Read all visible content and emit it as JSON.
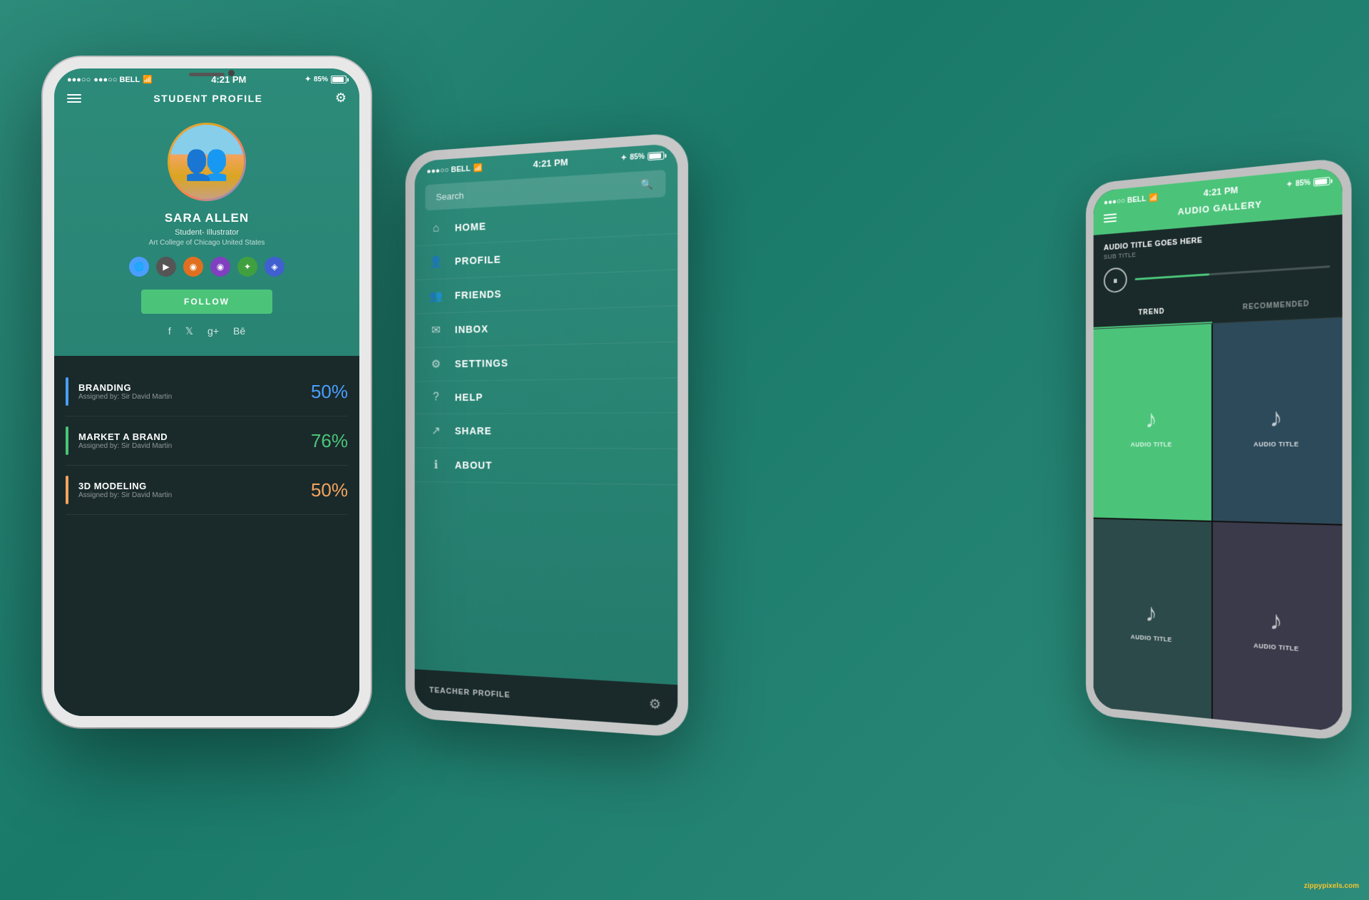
{
  "background": {
    "color": "#2d8b7a"
  },
  "phone1": {
    "status_bar": {
      "carrier": "●●●○○ BELL",
      "wifi": "WiFi",
      "time": "4:21 PM",
      "bluetooth": "✦",
      "battery": "85%"
    },
    "header": {
      "title": "STUDENT PROFILE"
    },
    "profile": {
      "name": "SARA ALLEN",
      "role": "Student- Illustrator",
      "school": "Art College of Chicago United States"
    },
    "follow_button": "FOLLOW",
    "social_links": [
      "f",
      "𝕏",
      "g+",
      "Bē"
    ],
    "courses": [
      {
        "name": "BRANDING",
        "assigned": "Assigned by: Sir David Martin",
        "percent": "50%",
        "color": "#4a9eff",
        "color_class": "blue"
      },
      {
        "name": "MARKET A BRAND",
        "assigned": "Assigned by: Sir David Martin",
        "percent": "76%",
        "color": "#4bc47a",
        "color_class": "green"
      },
      {
        "name": "3D Modeling",
        "assigned": "Assigned by: Sir David Martin",
        "percent": "50%",
        "color": "#f4a460",
        "color_class": "orange"
      }
    ]
  },
  "phone2": {
    "status_bar": {
      "carrier": "●●●○○ BELL",
      "wifi": "WiFi",
      "time": "4:21 PM",
      "bluetooth": "✦",
      "battery": "85%"
    },
    "search": {
      "placeholder": "Search"
    },
    "menu_items": [
      {
        "label": "HOME",
        "icon": "⌂"
      },
      {
        "label": "PROFILE",
        "icon": "♟"
      },
      {
        "label": "FRIENDS",
        "icon": "♟♟"
      },
      {
        "label": "INBOX",
        "icon": "✉"
      },
      {
        "label": "SETTINGS",
        "icon": "⚙"
      },
      {
        "label": "HELP",
        "icon": "?"
      },
      {
        "label": "SHARE",
        "icon": "↗"
      },
      {
        "label": "ABOUT",
        "icon": "ℹ"
      }
    ],
    "teacher_profile_label": "TEACHER PROFILE"
  },
  "phone3": {
    "status_bar": {
      "carrier": "●●●○○ BELL",
      "wifi": "WiFi",
      "time": "4:21 PM",
      "bluetooth": "✦",
      "battery": "85%"
    },
    "header": {
      "title": "AUDIO GALLERY"
    },
    "now_playing": {
      "title": "AUDIO TITLE GOES HERE",
      "subtitle": "SUB TITLE",
      "progress": 40
    },
    "tabs": [
      {
        "label": "TREND",
        "active": true
      },
      {
        "label": "RECOMMENDED",
        "active": false
      }
    ],
    "audio_cards": [
      {
        "label": "AUDIO TITLE"
      },
      {
        "label": "AUDIO TITLE"
      },
      {
        "label": "AUDIO TITLE"
      },
      {
        "label": "AUDIO TITLE"
      }
    ]
  },
  "watermark": {
    "text_plain": "zippy",
    "text_colored": "pixels",
    "suffix": ".com"
  }
}
